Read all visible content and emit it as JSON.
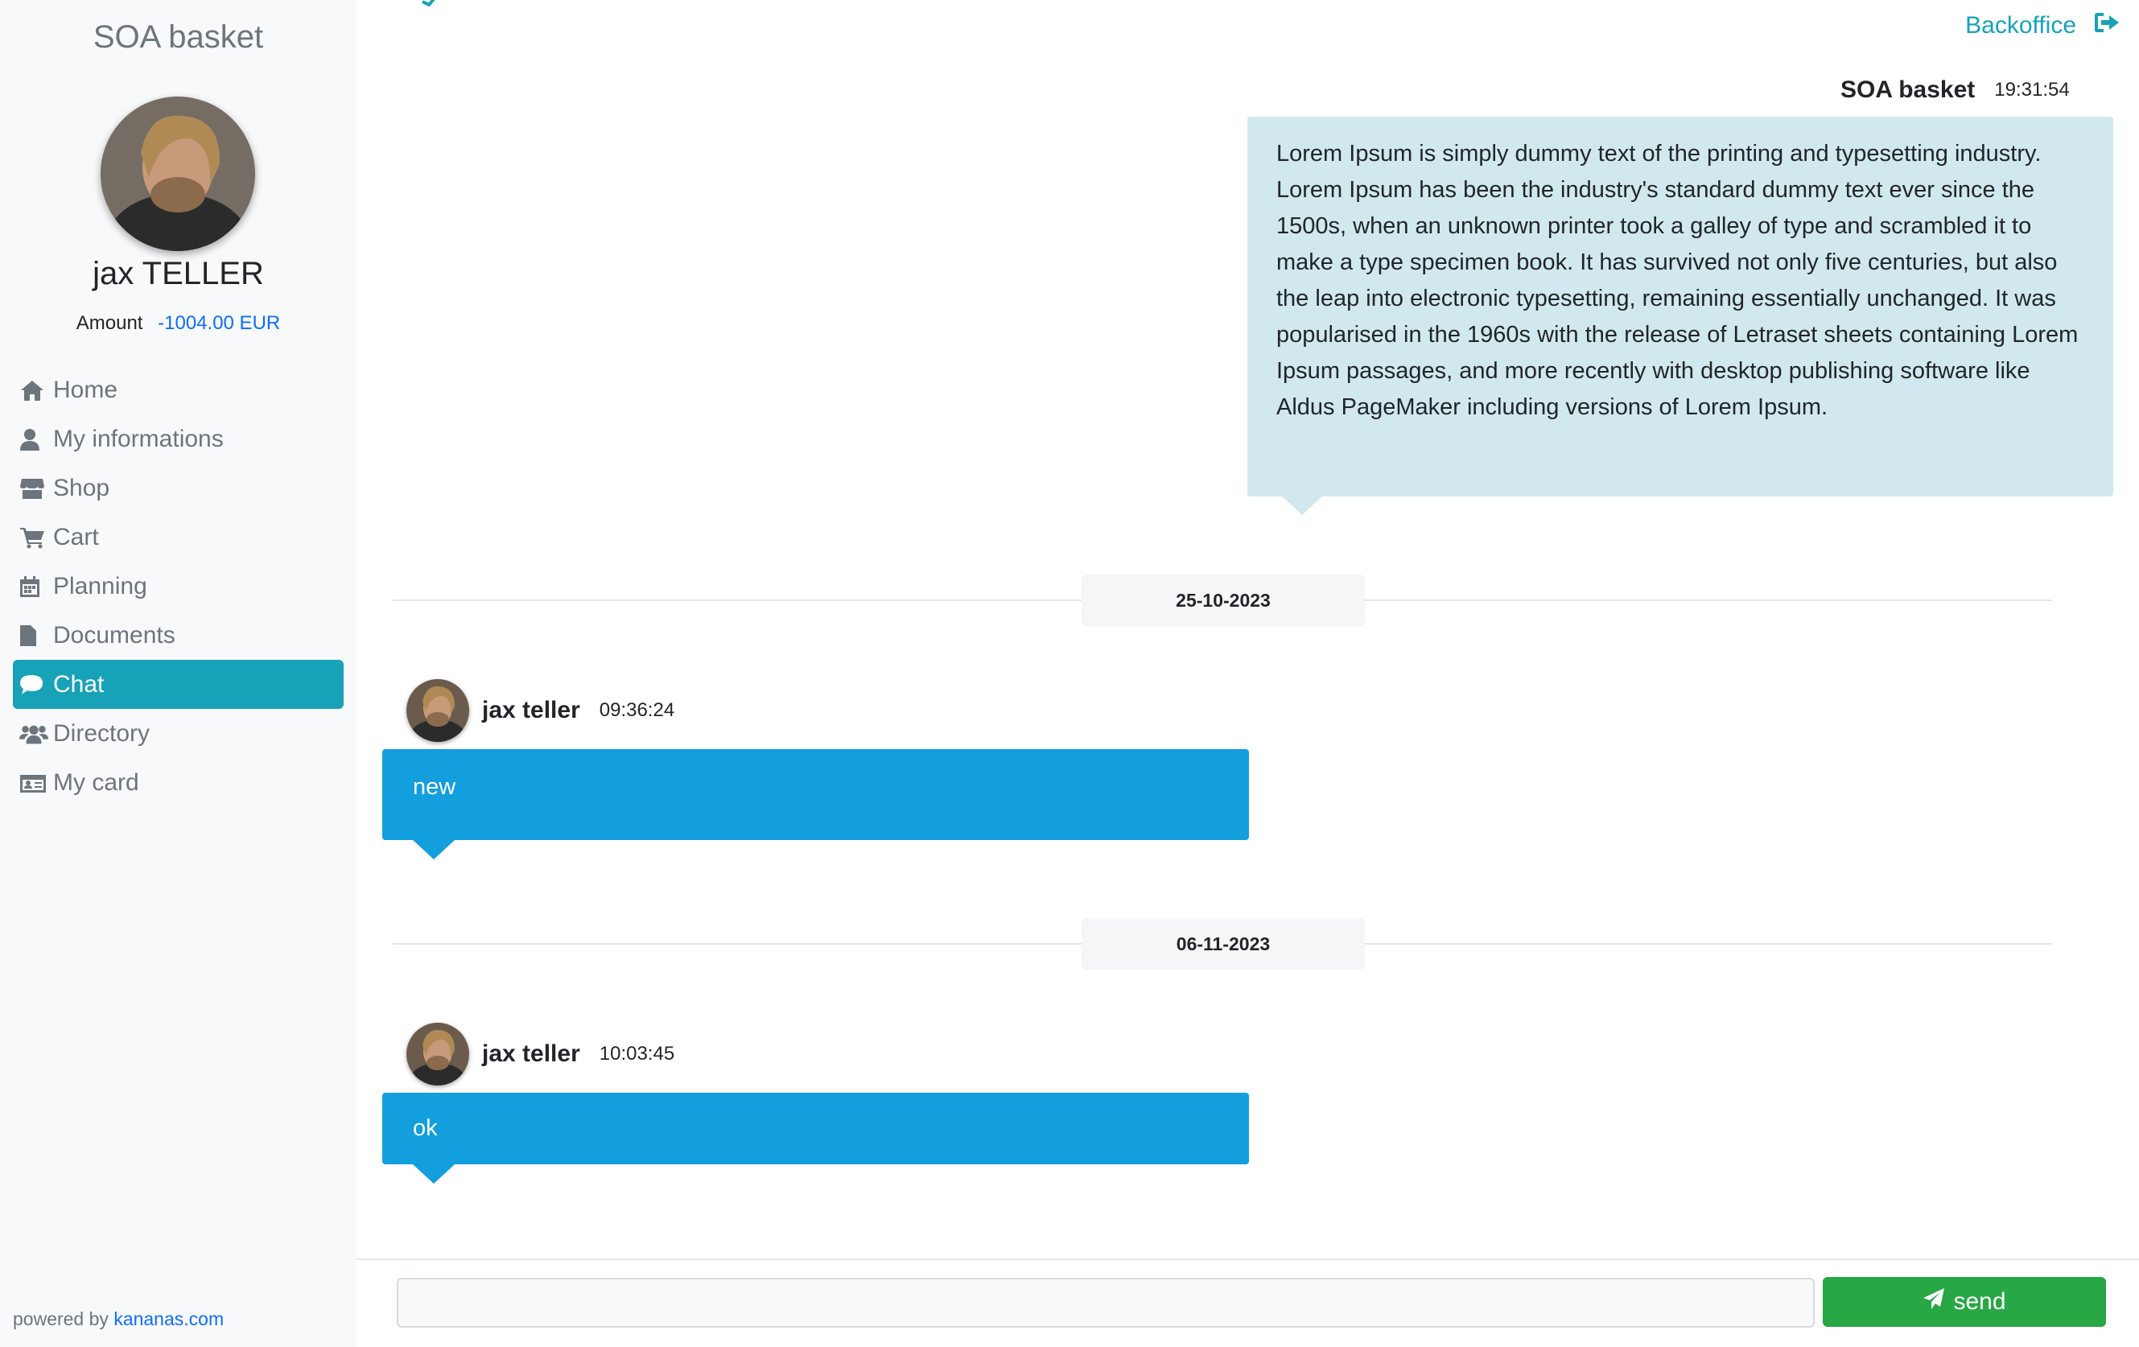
{
  "sidebar": {
    "brand": "SOA basket",
    "user_name": "jax TELLER",
    "amount_label": "Amount",
    "amount_value": "-1004.00 EUR",
    "amount_color": "#0d6efd",
    "nav": [
      {
        "label": "Home",
        "icon": "home-icon"
      },
      {
        "label": "My informations",
        "icon": "user-icon"
      },
      {
        "label": "Shop",
        "icon": "shop-icon"
      },
      {
        "label": "Cart",
        "icon": "cart-icon"
      },
      {
        "label": "Planning",
        "icon": "calendar-icon"
      },
      {
        "label": "Documents",
        "icon": "document-icon"
      },
      {
        "label": "Chat",
        "icon": "chat-icon",
        "active": true
      },
      {
        "label": "Directory",
        "icon": "users-icon"
      },
      {
        "label": "My card",
        "icon": "id-card-icon"
      }
    ],
    "active_color": "#17a2b8",
    "powered_prefix": "powered by",
    "powered_link": "kananas.com"
  },
  "header": {
    "backoffice_label": "Backoffice",
    "backoffice_icon": "sign-out-icon"
  },
  "messages": [
    {
      "author": "SOA basket",
      "time": "19:31:54",
      "side": "right",
      "text": "Lorem Ipsum is simply dummy text of the printing and typesetting industry. Lorem Ipsum has been the industry's standard dummy text ever since the 1500s, when an unknown printer took a galley of type and scrambled it to make a type specimen book. It has survived not only five centuries, but also the leap into electronic typesetting, remaining essentially unchanged. It was popularised in the 1960s with the release of Letraset sheets containing Lorem Ipsum passages, and more recently with desktop publishing software like Aldus PageMaker including versions of Lorem Ipsum."
    },
    {
      "date": "25-10-2023",
      "author": "jax teller",
      "time": "09:36:24",
      "side": "left",
      "text": "new"
    },
    {
      "date": "06-11-2023",
      "author": "jax teller",
      "time": "10:03:45",
      "side": "left",
      "text": "ok"
    }
  ],
  "composer": {
    "input_value": "",
    "send_label": "send",
    "send_icon": "paper-plane-icon",
    "send_color": "#28a745"
  },
  "colors": {
    "incoming_bubble": "#139edd",
    "outgoing_bubble": "#d1e9ee"
  }
}
